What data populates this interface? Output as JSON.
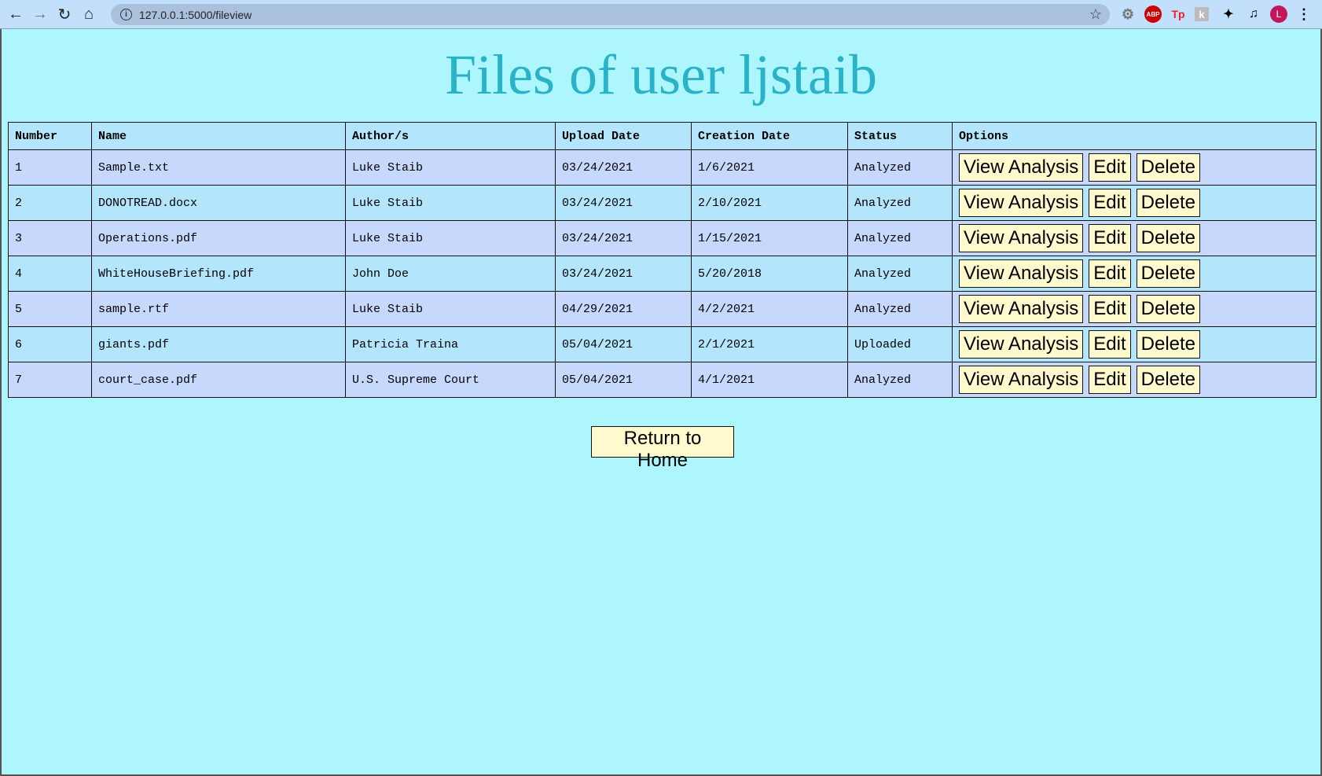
{
  "browser": {
    "url": "127.0.0.1:5000/fileview",
    "avatar_letter": "L",
    "extensions": [
      "gear-extension",
      "adblock-plus",
      "tp-extension",
      "k-extension",
      "puzzle-extensions",
      "media-control"
    ]
  },
  "title": "Files of user ljstaib",
  "table": {
    "headers": [
      "Number",
      "Name",
      "Author/s",
      "Upload Date",
      "Creation Date",
      "Status",
      "Options"
    ],
    "rows": [
      {
        "number": "1",
        "name": "Sample.txt",
        "author": "Luke Staib",
        "upload": "03/24/2021",
        "created": "1/6/2021",
        "status": "Analyzed"
      },
      {
        "number": "2",
        "name": "DONOTREAD.docx",
        "author": "Luke Staib",
        "upload": "03/24/2021",
        "created": "2/10/2021",
        "status": "Analyzed"
      },
      {
        "number": "3",
        "name": "Operations.pdf",
        "author": "Luke Staib",
        "upload": "03/24/2021",
        "created": "1/15/2021",
        "status": "Analyzed"
      },
      {
        "number": "4",
        "name": "WhiteHouseBriefing.pdf",
        "author": "John Doe",
        "upload": "03/24/2021",
        "created": "5/20/2018",
        "status": "Analyzed"
      },
      {
        "number": "5",
        "name": "sample.rtf",
        "author": "Luke Staib",
        "upload": "04/29/2021",
        "created": "4/2/2021",
        "status": "Analyzed"
      },
      {
        "number": "6",
        "name": "giants.pdf",
        "author": "Patricia Traina",
        "upload": "05/04/2021",
        "created": "2/1/2021",
        "status": "Uploaded"
      },
      {
        "number": "7",
        "name": "court_case.pdf",
        "author": "U.S. Supreme Court",
        "upload": "05/04/2021",
        "created": "4/1/2021",
        "status": "Analyzed"
      }
    ],
    "buttons": {
      "view": "View Analysis",
      "edit": "Edit",
      "delete": "Delete"
    }
  },
  "return_home": "Return to Home",
  "colors": {
    "background": "#aef6fe",
    "title": "#2ab2c9",
    "button": "#fffacd",
    "row_odd": "#c6d9fd",
    "row_even": "#b3e5fc"
  }
}
